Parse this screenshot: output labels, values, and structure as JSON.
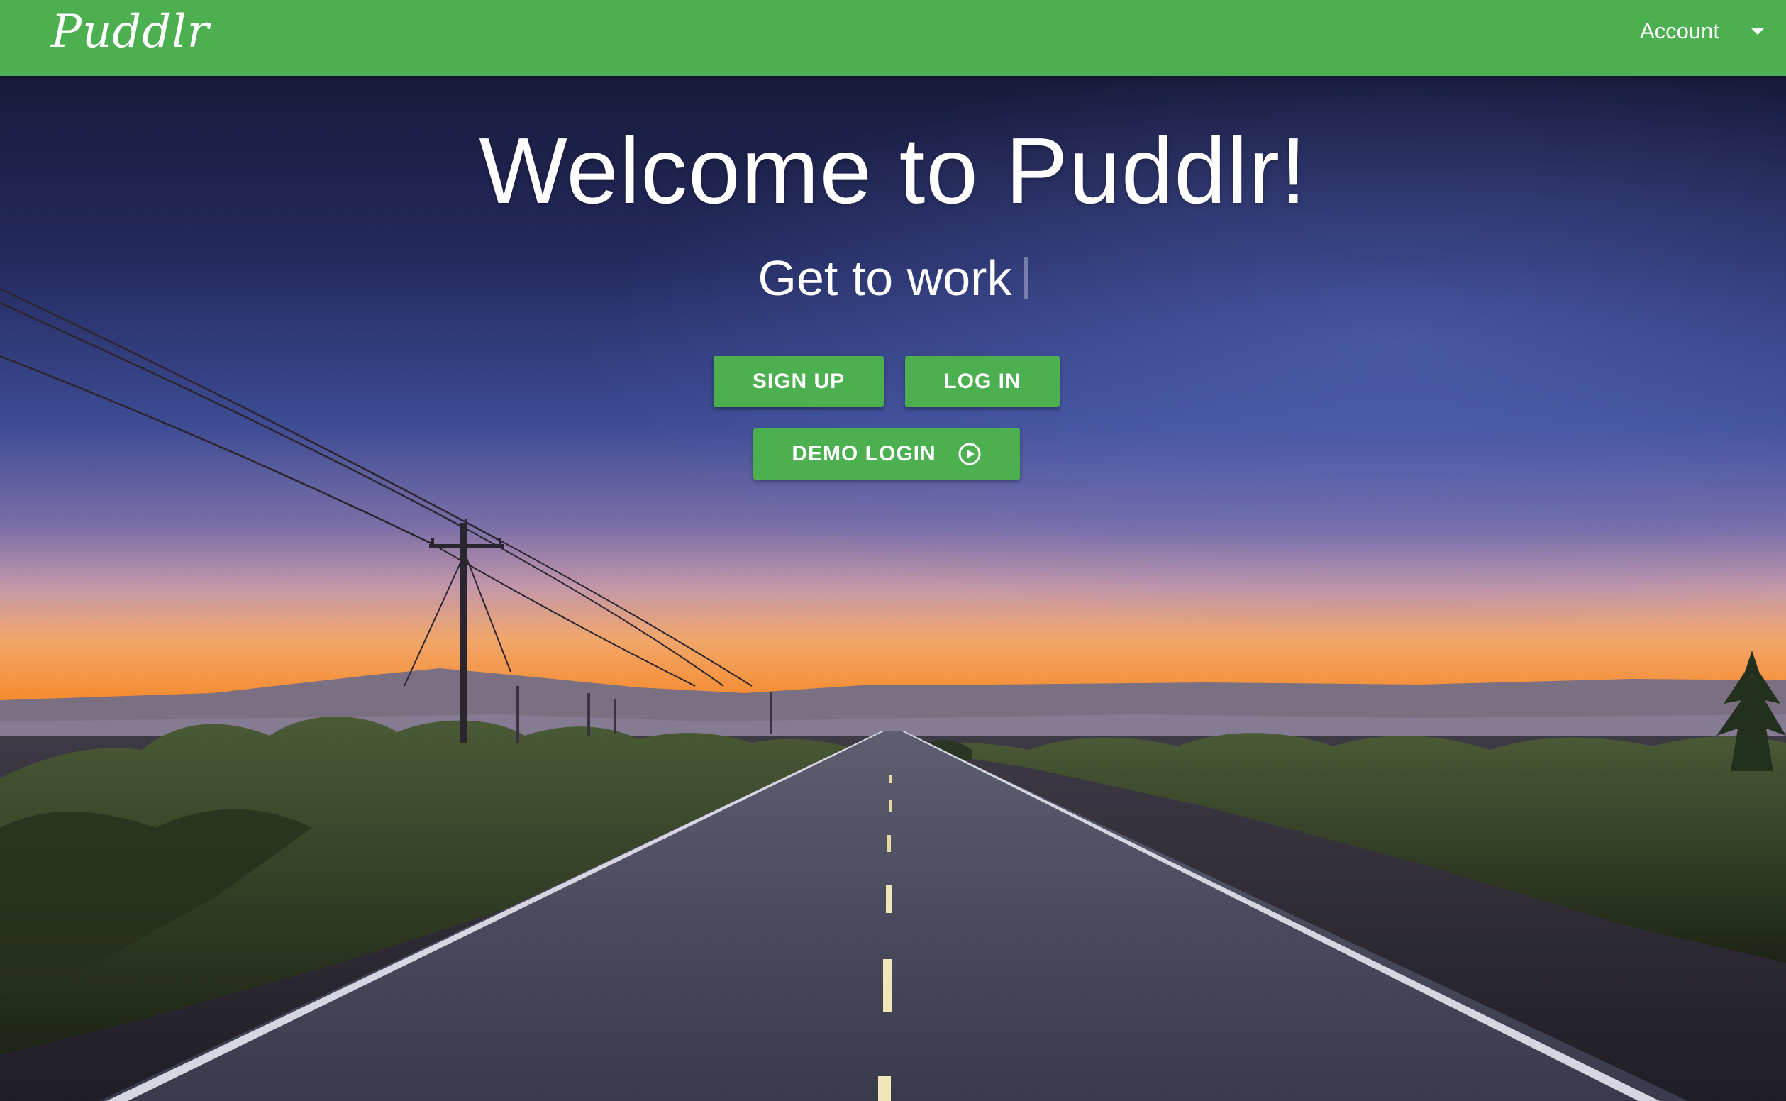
{
  "navbar": {
    "brand": "Puddlr",
    "account_label": "Account",
    "account_icon": "caret-down-icon"
  },
  "hero": {
    "title": "Welcome to Puddlr!",
    "subtitle": "Get to work",
    "buttons": {
      "signup": "SIGN UP",
      "login": "LOG IN",
      "demo": "DEMO LOGIN",
      "demo_icon": "play-circle-icon"
    }
  },
  "colors": {
    "primary": "#4caf50",
    "text": "#ffffff"
  }
}
